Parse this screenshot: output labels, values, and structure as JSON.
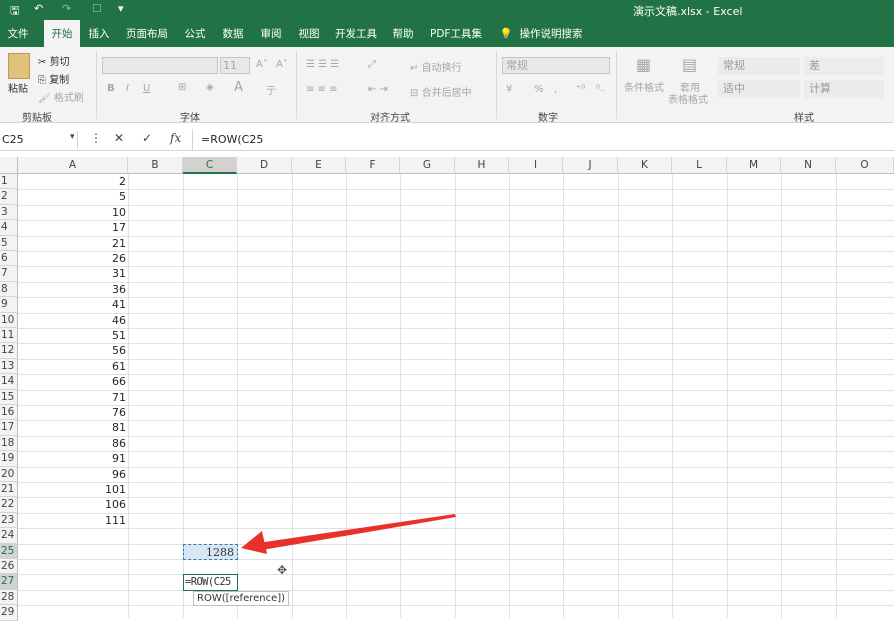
{
  "title": "演示文稿.xlsx - Excel",
  "tabs": [
    "文件",
    "开始",
    "插入",
    "页面布局",
    "公式",
    "数据",
    "审阅",
    "视图",
    "开发工具",
    "帮助",
    "PDF工具集"
  ],
  "active_tab": "开始",
  "tell_me": "操作说明搜索",
  "ribbon": {
    "clipboard": {
      "paste": "粘贴",
      "cut": "剪切",
      "copy": "复制",
      "format_painter": "格式刷",
      "label": "剪贴板"
    },
    "font": {
      "size": "11",
      "bold": "B",
      "italic": "I",
      "underline": "U",
      "label": "字体"
    },
    "alignment": {
      "wrap": "自动换行",
      "merge": "合并后居中",
      "label": "对齐方式"
    },
    "number": {
      "format": "常规",
      "percent": "%",
      "label": "数字"
    },
    "styles": {
      "conditional": "条件格式",
      "table_line1": "套用",
      "table_line2": "表格格式",
      "normal": "常规",
      "bad": "差",
      "neutral": "适中",
      "calc": "计算",
      "label": "样式"
    }
  },
  "formula_bar": {
    "name_box": "C25",
    "cancel": "✕",
    "enter": "✓",
    "fx": "fx",
    "formula": "=ROW(C25"
  },
  "columns": [
    "A",
    "B",
    "C",
    "D",
    "E",
    "F",
    "G",
    "H",
    "I",
    "J",
    "K",
    "L",
    "M",
    "N",
    "O"
  ],
  "rows": [
    "1",
    "2",
    "3",
    "4",
    "5",
    "6",
    "7",
    "8",
    "9",
    "10",
    "11",
    "12",
    "13",
    "14",
    "15",
    "16",
    "17",
    "18",
    "19",
    "20",
    "21",
    "22",
    "23",
    "24",
    "25",
    "26",
    "27",
    "28",
    "29"
  ],
  "col_a_values": [
    "2",
    "5",
    "10",
    "17",
    "21",
    "26",
    "31",
    "36",
    "41",
    "46",
    "51",
    "56",
    "61",
    "66",
    "71",
    "76",
    "81",
    "86",
    "91",
    "96",
    "101",
    "106",
    "111"
  ],
  "c25_value": "1288",
  "c27_formula": "=ROW(C25",
  "tooltip": {
    "text": "ROW([reference])"
  },
  "arrow_color": "#e8312a",
  "accent": "#217346"
}
